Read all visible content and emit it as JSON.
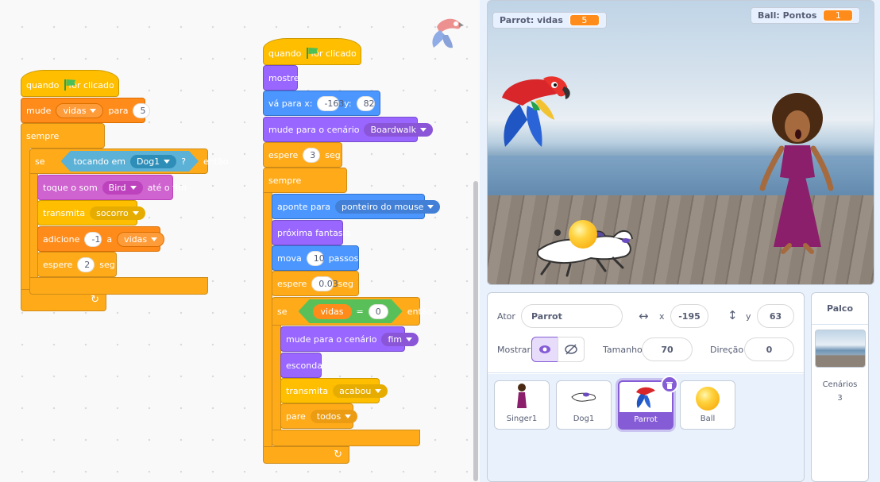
{
  "workspace": {
    "script1": {
      "when_flag": "quando",
      "when_flag_suffix": "for clicado",
      "set_label": "mude",
      "set_var": "vidas",
      "set_to": "para",
      "set_value": "5",
      "forever": "sempre",
      "if": "se",
      "touching": "tocando em",
      "touching_target": "Dog1",
      "touching_q": "?",
      "then": "então",
      "play_sound": "toque o som",
      "sound_name": "Bird",
      "until_done": "até o fim",
      "broadcast": "transmita",
      "broadcast_msg": "socorro",
      "change": "adicione",
      "change_value": "-1",
      "change_to": "a",
      "change_var": "vidas",
      "wait": "espere",
      "wait_value": "2",
      "wait_unit": "seg"
    },
    "script2": {
      "when_flag": "quando",
      "when_flag_suffix": "for clicado",
      "show": "mostre",
      "goto": "vá para x:",
      "goto_x": "-163",
      "goto_y_label": "y:",
      "goto_y": "82",
      "switch_backdrop": "mude para o cenário",
      "backdrop": "Boardwalk",
      "wait": "espere",
      "wait_value": "3",
      "wait_unit": "seg",
      "forever": "sempre",
      "point_towards": "aponte para",
      "point_target": "ponteiro do mouse",
      "next_costume": "próxima fantasia",
      "move": "mova",
      "move_steps": "10",
      "move_unit": "passos",
      "wait2": "espere",
      "wait2_value": "0.03",
      "wait2_unit": "seg",
      "if": "se",
      "if_var": "vidas",
      "if_eq": "=",
      "if_value": "0",
      "then": "então",
      "switch_backdrop2": "mude para o cenário",
      "backdrop2": "fim",
      "hide": "esconda",
      "broadcast": "transmita",
      "broadcast_msg": "acabou",
      "stop": "pare",
      "stop_option": "todos"
    }
  },
  "stage": {
    "monitor_lives": {
      "label": "Parrot: vidas",
      "value": "5"
    },
    "monitor_points": {
      "label": "Ball: Pontos",
      "value": "1"
    }
  },
  "sprite_info": {
    "sprite_label": "Ator",
    "sprite_name": "Parrot",
    "x_label": "x",
    "x_value": "-195",
    "y_label": "y",
    "y_value": "63",
    "show_label": "Mostrar",
    "size_label": "Tamanho",
    "size_value": "70",
    "direction_label": "Direção",
    "direction_value": "0"
  },
  "sprites": [
    {
      "name": "Singer1"
    },
    {
      "name": "Dog1"
    },
    {
      "name": "Parrot"
    },
    {
      "name": "Ball"
    }
  ],
  "stage_pane": {
    "title": "Palco",
    "backdrops_label": "Cenários",
    "backdrops_count": "3"
  },
  "colors": {
    "events": "#ffbf00",
    "control": "#ffab19",
    "variables": "#ff8c1a",
    "sensing": "#5cb1d6",
    "sound": "#cf63cf",
    "motion": "#4c97ff",
    "looks": "#9966ff",
    "operators": "#59c059",
    "selection": "#855cd6"
  }
}
